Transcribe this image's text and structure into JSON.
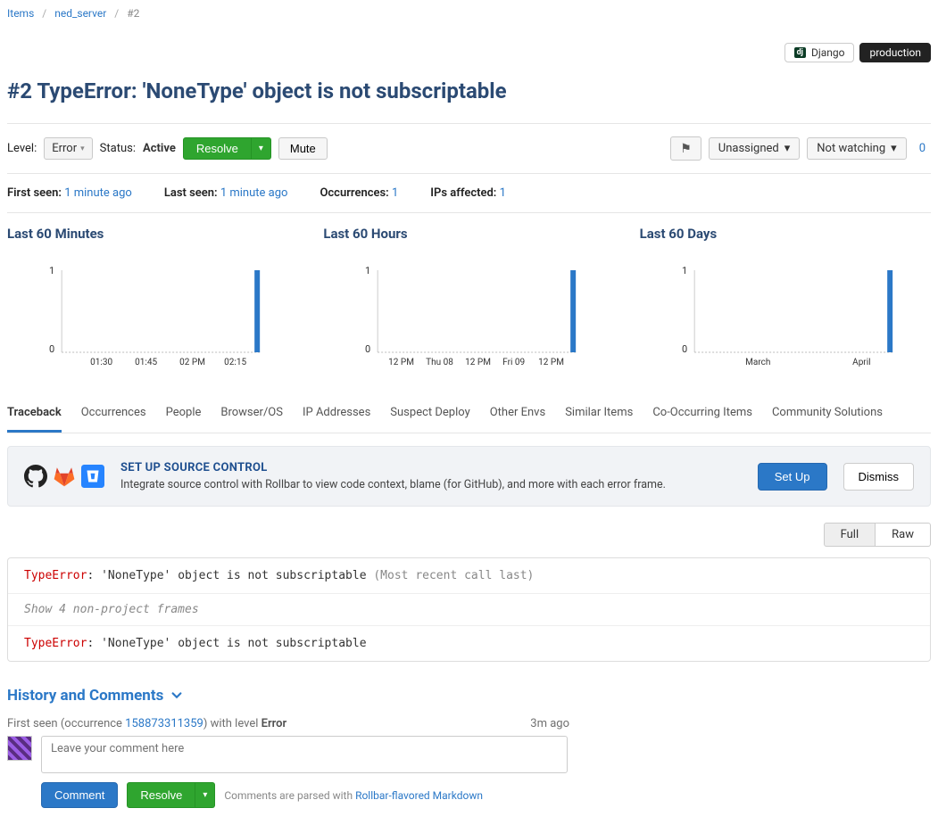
{
  "breadcrumb": {
    "items": "Items",
    "project": "ned_server",
    "current": "#2"
  },
  "tags": {
    "framework": "Django",
    "env": "production"
  },
  "title": "#2 TypeError: 'NoneType' object is not subscriptable",
  "controls": {
    "level_label": "Level:",
    "level_value": "Error",
    "status_label": "Status:",
    "status_value": "Active",
    "resolve": "Resolve",
    "mute": "Mute",
    "flag": "⚑",
    "assignee": "Unassigned",
    "watching": "Not watching",
    "watchers_count": "0"
  },
  "meta": {
    "first_seen_k": "First seen:",
    "first_seen_v": "1 minute ago",
    "last_seen_k": "Last seen:",
    "last_seen_v": "1 minute ago",
    "occurrences_k": "Occurrences:",
    "occurrences_v": "1",
    "ips_k": "IPs affected:",
    "ips_v": "1"
  },
  "charts": {
    "minutes": {
      "title": "Last 60 Minutes",
      "ylabel": "1",
      "zero": "0",
      "xticks": [
        "01:30",
        "01:45",
        "02 PM",
        "02:15"
      ]
    },
    "hours": {
      "title": "Last 60 Hours",
      "ylabel": "1",
      "zero": "0",
      "xticks": [
        "12 PM",
        "Thu 08",
        "12 PM",
        "Fri 09",
        "12 PM"
      ]
    },
    "days": {
      "title": "Last 60 Days",
      "ylabel": "1",
      "zero": "0",
      "xticks": [
        "March",
        "April"
      ]
    }
  },
  "tabs": [
    "Traceback",
    "Occurrences",
    "People",
    "Browser/OS",
    "IP Addresses",
    "Suspect Deploy",
    "Other Envs",
    "Similar Items",
    "Co-Occurring Items",
    "Community Solutions"
  ],
  "src_control": {
    "heading": "SET UP SOURCE CONTROL",
    "body": "Integrate source control with Rollbar to view code context, blame (for GitHub), and more with each error frame.",
    "setup": "Set Up",
    "dismiss": "Dismiss"
  },
  "view_toggle": {
    "full": "Full",
    "raw": "Raw"
  },
  "traceback": {
    "err": "TypeError",
    "msg": ": 'NoneType' object is not subscriptable ",
    "hint": "(Most recent call last)",
    "expand": "Show 4 non-project frames",
    "err2": "TypeError",
    "msg2": ": 'NoneType' object is not subscriptable"
  },
  "history": {
    "heading": "History and Comments",
    "first_seen_prefix": "First seen (occurrence ",
    "occurrence_id": "158873311359",
    "suffix": ") with level ",
    "level": "Error",
    "time_ago": "3m ago",
    "placeholder": "Leave your comment here",
    "comment_btn": "Comment",
    "resolve_btn": "Resolve",
    "md_prefix": "Comments are parsed with ",
    "md_link": "Rollbar-flavored Markdown"
  },
  "chart_data": [
    {
      "type": "bar",
      "title": "Last 60 Minutes",
      "categories": [
        "01:30",
        "01:45",
        "02 PM",
        "02:15"
      ],
      "values": [
        0,
        0,
        0,
        1
      ],
      "ylim": [
        0,
        1
      ],
      "xlabel": "",
      "ylabel": ""
    },
    {
      "type": "bar",
      "title": "Last 60 Hours",
      "categories": [
        "12 PM",
        "Thu 08",
        "12 PM",
        "Fri 09",
        "12 PM"
      ],
      "values": [
        0,
        0,
        0,
        0,
        1
      ],
      "ylim": [
        0,
        1
      ],
      "xlabel": "",
      "ylabel": ""
    },
    {
      "type": "bar",
      "title": "Last 60 Days",
      "categories": [
        "March",
        "April"
      ],
      "values": [
        0,
        1
      ],
      "ylim": [
        0,
        1
      ],
      "xlabel": "",
      "ylabel": ""
    }
  ]
}
